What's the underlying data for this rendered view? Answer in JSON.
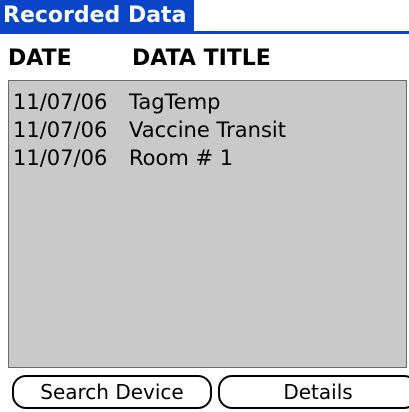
{
  "window": {
    "title": "Recorded Data"
  },
  "columns": {
    "date": "DATE",
    "title": "DATA TITLE"
  },
  "records": [
    {
      "date": "11/07/06",
      "title": "TagTemp"
    },
    {
      "date": "11/07/06",
      "title": "Vaccine Transit"
    },
    {
      "date": "11/07/06",
      "title": "Room # 1"
    }
  ],
  "buttons": {
    "search_label": "Search Device",
    "details_label": "Details"
  },
  "colors": {
    "title_bar": "#0a45c8",
    "list_background": "#c9c9c9"
  }
}
